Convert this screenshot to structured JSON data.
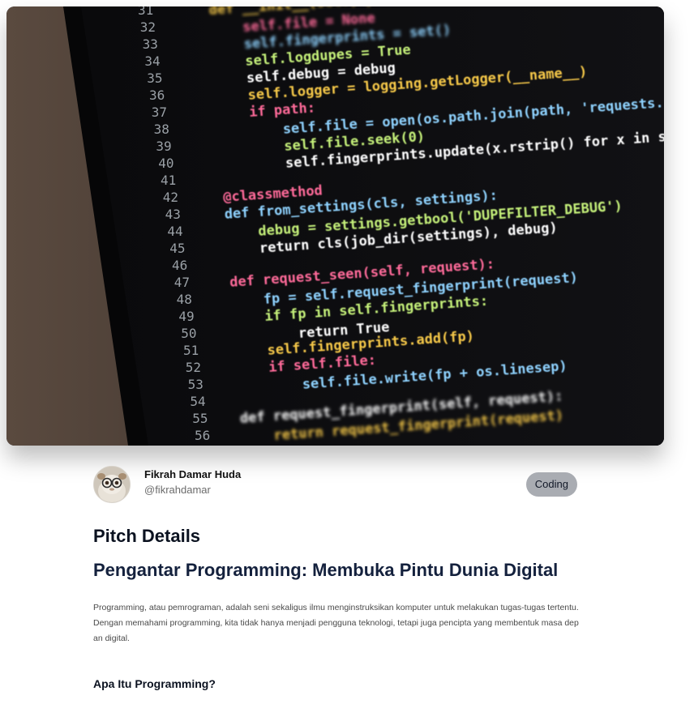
{
  "hero": {
    "code_lines": [
      {
        "n": "31",
        "code": "def __init__(self, path=None, debug=False):"
      },
      {
        "n": "32",
        "code": "self.file = None"
      },
      {
        "n": "33",
        "code": "self.fingerprints = set()"
      },
      {
        "n": "34",
        "code": "self.logdupes = True"
      },
      {
        "n": "35",
        "code": "self.debug = debug"
      },
      {
        "n": "36",
        "code": "self.logger = logging.getLogger(__name__)"
      },
      {
        "n": "37",
        "code": "if path:"
      },
      {
        "n": "38",
        "code": "self.file = open(os.path.join(path, 'requests.seen'), 'a+')"
      },
      {
        "n": "39",
        "code": "self.file.seek(0)"
      },
      {
        "n": "40",
        "code": "self.fingerprints.update(x.rstrip() for x in self.file)"
      },
      {
        "n": "41",
        "code": ""
      },
      {
        "n": "42",
        "code": "@classmethod"
      },
      {
        "n": "43",
        "code": "def from_settings(cls, settings):"
      },
      {
        "n": "44",
        "code": "debug = settings.getbool('DUPEFILTER_DEBUG')"
      },
      {
        "n": "45",
        "code": "return cls(job_dir(settings), debug)"
      },
      {
        "n": "46",
        "code": ""
      },
      {
        "n": "47",
        "code": "def request_seen(self, request):"
      },
      {
        "n": "48",
        "code": "fp = self.request_fingerprint(request)"
      },
      {
        "n": "49",
        "code": "if fp in self.fingerprints:"
      },
      {
        "n": "50",
        "code": "return True"
      },
      {
        "n": "51",
        "code": "self.fingerprints.add(fp)"
      },
      {
        "n": "52",
        "code": "if self.file:"
      },
      {
        "n": "53",
        "code": "self.file.write(fp + os.linesep)"
      },
      {
        "n": "54",
        "code": ""
      },
      {
        "n": "55",
        "code": "def request_fingerprint(self, request):"
      },
      {
        "n": "56",
        "code": "return request_fingerprint(request)"
      }
    ]
  },
  "author": {
    "name": "Fikrah Damar Huda",
    "handle": "@fikrahdamar"
  },
  "category_badge": "Coding",
  "section_title": "Pitch Details",
  "pitch": {
    "title": "Pengantar Programming: Membuka Pintu Dunia Digital",
    "intro": "Programming, atau pemrograman, adalah seni sekaligus ilmu menginstruksikan komputer untuk melakukan tugas-tugas tertentu. Dengan memahami programming, kita tidak hanya menjadi pengguna teknologi, tetapi juga pencipta yang membentuk masa depan digital.",
    "subheading": "Apa Itu Programming?"
  },
  "colors": {
    "badge_bg": "#a9acb2",
    "title": "#14213d",
    "code_bg": "#0d0d0f"
  }
}
